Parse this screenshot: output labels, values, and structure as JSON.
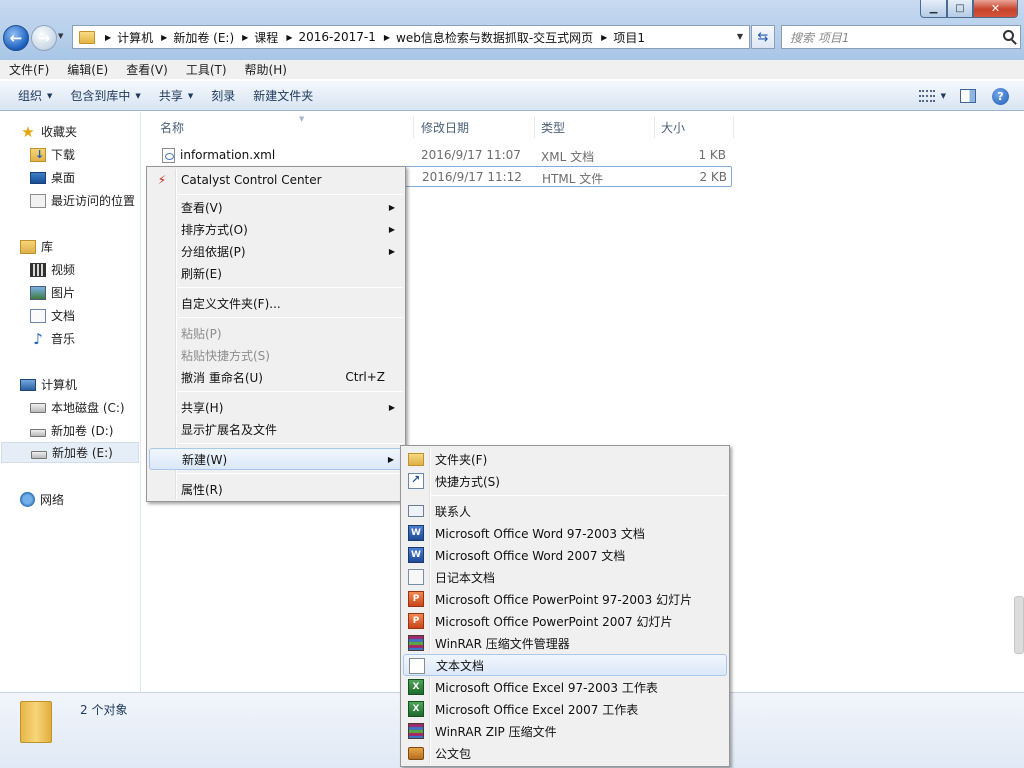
{
  "window": {
    "min_glyph": "▁",
    "max_glyph": "□",
    "close_glyph": "✕"
  },
  "address": {
    "breadcrumbs": [
      "计算机",
      "新加卷 (E:)",
      "课程",
      "2016-2017-1",
      "web信息检索与数据抓取-交互式网页",
      "项目1"
    ]
  },
  "search": {
    "placeholder": "搜索 项目1"
  },
  "menubar": [
    "文件(F)",
    "编辑(E)",
    "查看(V)",
    "工具(T)",
    "帮助(H)"
  ],
  "cmdbar": {
    "organize": "组织",
    "include_library": "包含到库中",
    "share": "共享",
    "burn": "刻录",
    "new_folder": "新建文件夹"
  },
  "navpane": {
    "favorites": "收藏夹",
    "downloads": "下载",
    "desktop": "桌面",
    "recent": "最近访问的位置",
    "libraries": "库",
    "videos": "视频",
    "pictures": "图片",
    "documents": "文档",
    "music": "音乐",
    "computer": "计算机",
    "drive_c": "本地磁盘 (C:)",
    "drive_d": "新加卷 (D:)",
    "drive_e": "新加卷 (E:)",
    "network": "网络"
  },
  "columns": {
    "name": "名称",
    "date": "修改日期",
    "type": "类型",
    "size": "大小"
  },
  "files": [
    {
      "name": "information.xml",
      "date": "2016/9/17 11:07",
      "type": "XML 文档",
      "size": "1 KB"
    },
    {
      "name": "",
      "date": "2016/9/17 11:12",
      "type": "HTML 文件",
      "size": "2 KB"
    }
  ],
  "status": {
    "count": "2 个对象"
  },
  "context_menu": {
    "catalyst": "Catalyst Control Center",
    "view": "查看(V)",
    "sort_by": "排序方式(O)",
    "group_by": "分组依据(P)",
    "refresh": "刷新(E)",
    "customize": "自定义文件夹(F)...",
    "paste": "粘贴(P)",
    "paste_shortcut": "粘贴快捷方式(S)",
    "undo_rename": "撤消 重命名(U)",
    "undo_shortcut": "Ctrl+Z",
    "share_with": "共享(H)",
    "show_ext": "显示扩展名及文件",
    "new": "新建(W)",
    "properties": "属性(R)"
  },
  "new_submenu": {
    "folder": "文件夹(F)",
    "shortcut": "快捷方式(S)",
    "contact": "联系人",
    "word97": "Microsoft Office Word 97-2003 文档",
    "word2007": "Microsoft Office Word 2007 文档",
    "journal": "日记本文档",
    "ppt97": "Microsoft Office PowerPoint 97-2003 幻灯片",
    "ppt2007": "Microsoft Office PowerPoint 2007 幻灯片",
    "winrar": "WinRAR 压缩文件管理器",
    "text": "文本文档",
    "excel97": "Microsoft Office Excel 97-2003 工作表",
    "excel2007": "Microsoft Office Excel 2007 工作表",
    "winrar_zip": "WinRAR ZIP 压缩文件",
    "briefcase": "公文包"
  }
}
